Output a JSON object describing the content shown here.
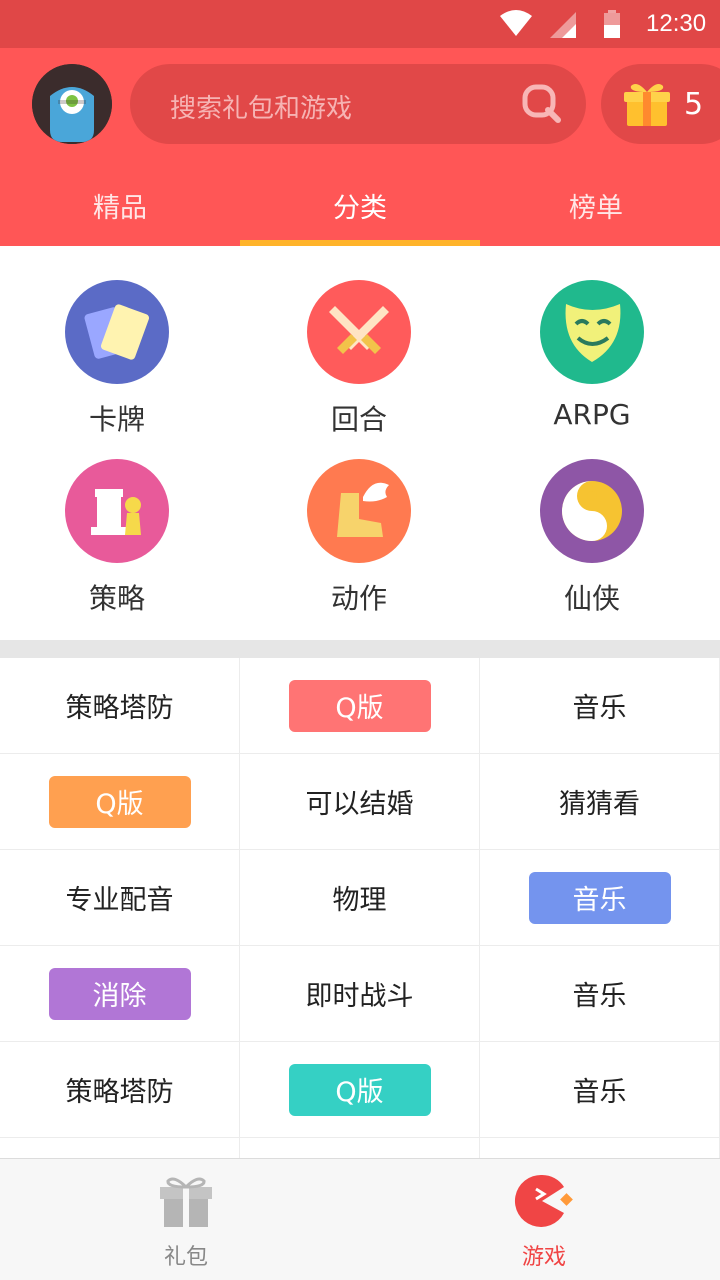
{
  "status_bar": {
    "time": "12:30",
    "icons": [
      "wifi-icon",
      "signal-icon",
      "battery-icon"
    ]
  },
  "header": {
    "search": {
      "placeholder": "搜索礼包和游戏",
      "icon": "search-icon"
    },
    "gift_count": "5",
    "tabs": [
      {
        "label": "精品",
        "active": false
      },
      {
        "label": "分类",
        "active": true
      },
      {
        "label": "榜单",
        "active": false
      }
    ]
  },
  "categories": [
    {
      "label": "卡牌",
      "icon": "cards-icon",
      "color": "#5b6bc6"
    },
    {
      "label": "回合",
      "icon": "crossed-swords-icon",
      "color": "#ff5b5b"
    },
    {
      "label": "ARPG",
      "icon": "theater-mask-icon",
      "color": "#20b98d"
    },
    {
      "label": "策略",
      "icon": "chess-icon",
      "color": "#e85a9a"
    },
    {
      "label": "动作",
      "icon": "winged-boot-icon",
      "color": "#ff7a50"
    },
    {
      "label": "仙侠",
      "icon": "yin-yang-icon",
      "color": "#8e56a6"
    }
  ],
  "tags": [
    [
      {
        "text": "策略塔防"
      },
      {
        "text": "Q版",
        "color": "#ff7474"
      },
      {
        "text": "音乐"
      }
    ],
    [
      {
        "text": "Q版",
        "color": "#ffa050"
      },
      {
        "text": "可以结婚"
      },
      {
        "text": "猜猜看"
      }
    ],
    [
      {
        "text": "专业配音"
      },
      {
        "text": "物理"
      },
      {
        "text": "音乐",
        "color": "#7494ee"
      }
    ],
    [
      {
        "text": "消除",
        "color": "#b176d6"
      },
      {
        "text": "即时战斗"
      },
      {
        "text": "音乐"
      }
    ],
    [
      {
        "text": "策略塔防"
      },
      {
        "text": "Q版",
        "color": "#35d0c4"
      },
      {
        "text": "音乐"
      }
    ]
  ],
  "bottom_nav": [
    {
      "label": "礼包",
      "icon": "gift-icon",
      "active": false
    },
    {
      "label": "游戏",
      "icon": "pacman-game-icon",
      "active": true
    }
  ],
  "colors": {
    "header": "#ff5656",
    "status_bar": "#e04747",
    "accent": "#ffb42a",
    "active_nav": "#f04545"
  }
}
